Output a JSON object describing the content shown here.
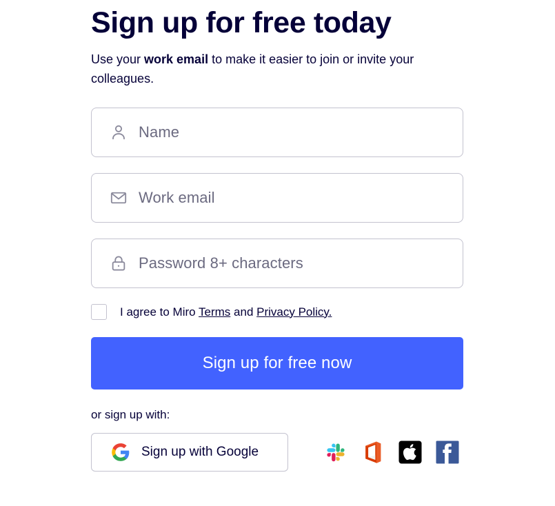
{
  "heading": "Sign up for free today",
  "subheading": {
    "before": "Use your ",
    "bold": "work email",
    "after": " to make it easier to join or invite your colleagues."
  },
  "fields": [
    {
      "icon": "person-icon",
      "placeholder": "Name",
      "value": ""
    },
    {
      "icon": "envelope-icon",
      "placeholder": "Work email",
      "value": ""
    },
    {
      "icon": "lock-icon",
      "placeholder": "Password 8+ characters",
      "value": ""
    }
  ],
  "agreement": {
    "checked": false,
    "lead": "I agree to Miro ",
    "terms_label": "Terms",
    "conjunction": " and ",
    "privacy_label": "Privacy Policy."
  },
  "primary_button": {
    "label": "Sign up for free now",
    "color": "#4262ff",
    "text_color": "#ffffff"
  },
  "alt_signup": {
    "label": "or sign up with:",
    "google_button_label": "Sign up with Google",
    "providers": [
      {
        "name": "slack-icon",
        "label": "Slack"
      },
      {
        "name": "microsoft-office-icon",
        "label": "Microsoft Office"
      },
      {
        "name": "apple-icon",
        "label": "Apple"
      },
      {
        "name": "facebook-icon",
        "label": "Facebook"
      }
    ]
  },
  "colors": {
    "brand_navy": "#050038",
    "accent_blue": "#4262ff",
    "border_gray": "#c3c2cf",
    "placeholder_gray": "#6b6a80",
    "slack_cyan": "#36c5f0",
    "slack_green": "#2eb67d",
    "slack_red": "#e01e5a",
    "slack_yellow": "#ecb22e",
    "office_red": "#d83b01",
    "apple_black": "#000000",
    "facebook_blue": "#3b5998",
    "google_red": "#ea4335",
    "google_yellow": "#fbbc05",
    "google_green": "#34a853",
    "google_blue": "#4285f4"
  }
}
